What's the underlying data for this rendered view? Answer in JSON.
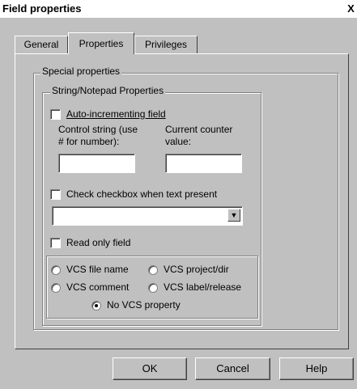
{
  "window": {
    "title": "Field properties",
    "close_symbol": "X"
  },
  "tabs": [
    {
      "label": "General",
      "active": false
    },
    {
      "label": "Properties",
      "active": true
    },
    {
      "label": "Privileges",
      "active": false
    }
  ],
  "special_properties": {
    "label": "Special properties",
    "string_notepad": {
      "label": "String/Notepad Properties",
      "auto_increment": {
        "label": "Auto-incrementing field",
        "checked": false
      },
      "control_string": {
        "label_line1": "Control string (use",
        "label_line2": "# for number):",
        "value": ""
      },
      "counter_value": {
        "label_line1": "Current counter",
        "label_line2": "value:",
        "value": ""
      },
      "check_when_text": {
        "label": "Check checkbox when text present",
        "checked": false
      },
      "checkbox_dropdown": {
        "value": ""
      },
      "read_only": {
        "label": "Read only field",
        "checked": false
      },
      "vcs": {
        "file_name": {
          "label": "VCS file name",
          "selected": false
        },
        "project_dir": {
          "label": "VCS project/dir",
          "selected": false
        },
        "comment": {
          "label": "VCS comment",
          "selected": false
        },
        "label_release": {
          "label": "VCS label/release",
          "selected": false
        },
        "none": {
          "label": "No VCS property",
          "selected": true
        }
      }
    }
  },
  "buttons": {
    "ok": "OK",
    "cancel": "Cancel",
    "help": "Help"
  }
}
